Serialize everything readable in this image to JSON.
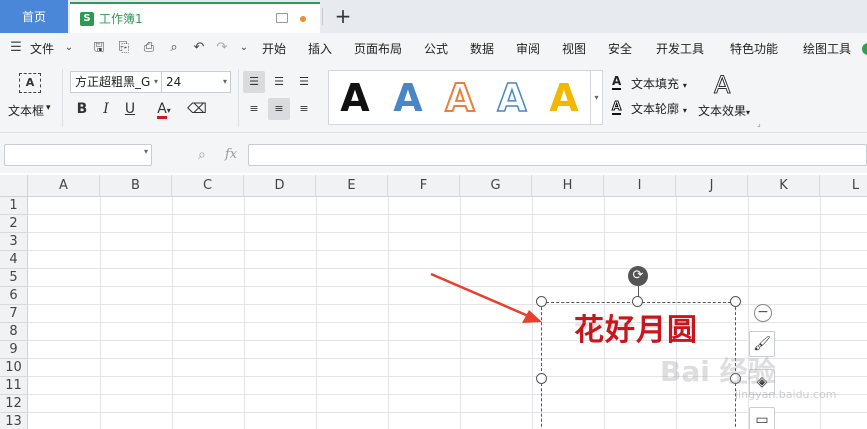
{
  "tabs": {
    "home": "首页",
    "doc": "工作簿1",
    "doc_logo": "S",
    "add": "+"
  },
  "menu": {
    "file": "文件",
    "items": [
      "开始",
      "插入",
      "页面布局",
      "公式",
      "数据",
      "审阅",
      "视图",
      "安全",
      "开发工具",
      "特色功能",
      "绘图工具"
    ]
  },
  "ribbon": {
    "textbox_label": "文本框",
    "font_name": "方正超粗黑_G",
    "font_size": "24",
    "bold": "B",
    "italic": "I",
    "underline": "U",
    "color": "A",
    "style_letter": "A",
    "style_colors": [
      "#111111",
      "#4a86c5",
      "#e8803a",
      "#4a86c5",
      "#f2b800"
    ],
    "text_fill": "文本填充",
    "text_outline": "文本轮廓",
    "text_effect": "文本效果"
  },
  "formula_bar": {
    "fx": "fx"
  },
  "columns": [
    "A",
    "B",
    "C",
    "D",
    "E",
    "F",
    "G",
    "H",
    "I",
    "J",
    "K",
    "L"
  ],
  "rows": [
    "1",
    "2",
    "3",
    "4",
    "5",
    "6",
    "7",
    "8",
    "9",
    "10",
    "11",
    "12",
    "13"
  ],
  "wordart": {
    "text": "花好月圆",
    "color": "#c8161d"
  },
  "watermark": {
    "text": "Bai 经验",
    "sub": "jingyan.baidu.com"
  }
}
